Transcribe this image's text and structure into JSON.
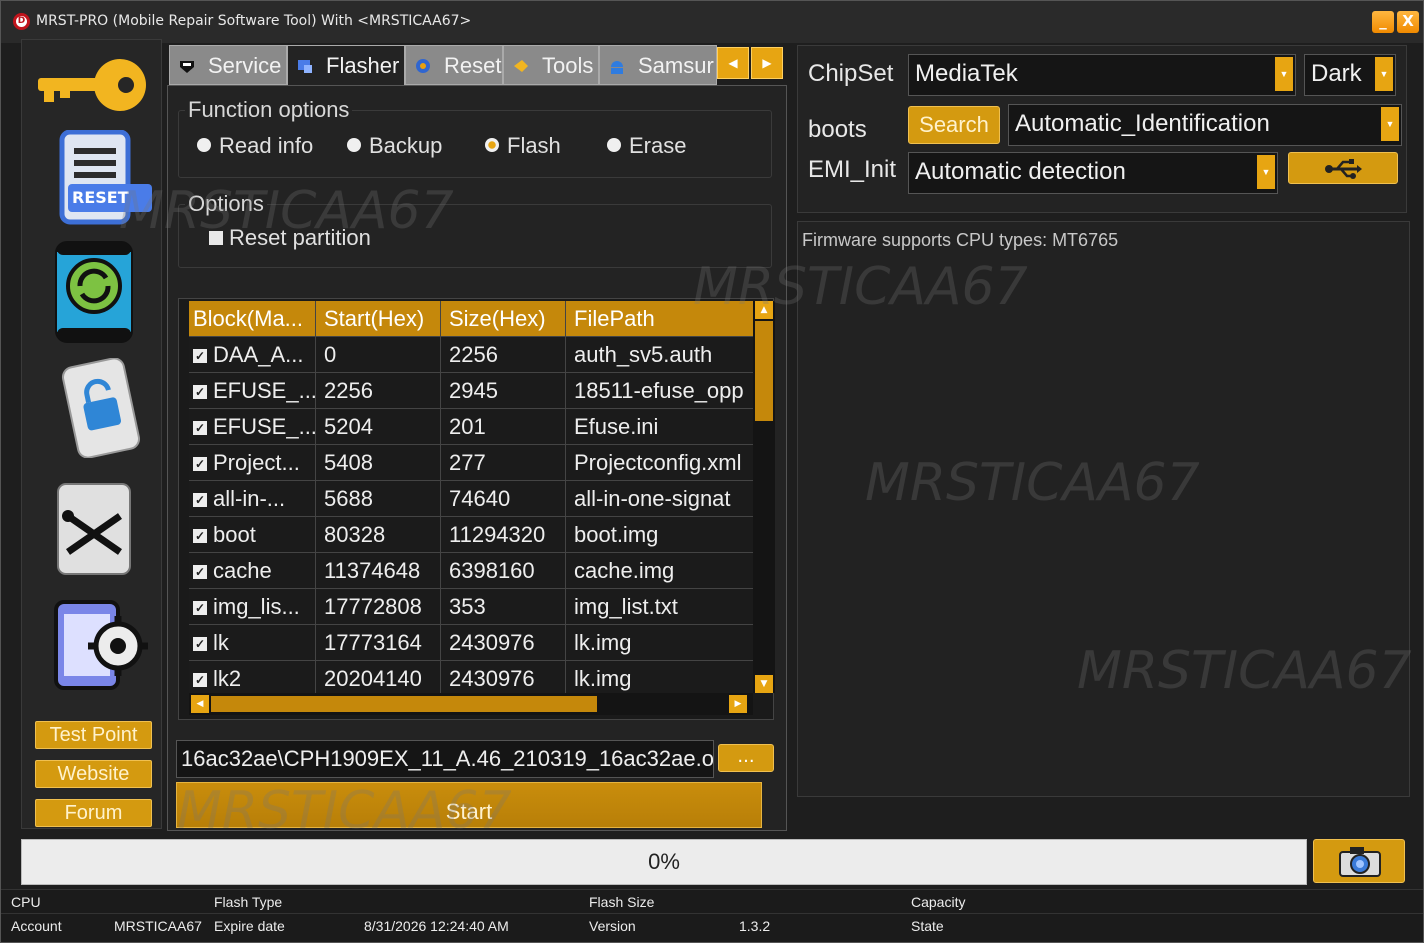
{
  "window": {
    "title": "MRST-PRO (Mobile Repair Software Tool)    With <MRSTICAA67>",
    "minimize_label": "_",
    "close_label": "X"
  },
  "sidebar": {
    "icons": [
      "key-icon",
      "reset-document-icon",
      "phone-sync-icon",
      "phone-unlock-icon",
      "tools-icon",
      "phone-settings-icon"
    ],
    "reset_badge": "RESET",
    "buttons": {
      "test_point": "Test Point",
      "website": "Website",
      "forum": "Forum"
    }
  },
  "tabs": [
    {
      "label": "Service",
      "icon": "service-icon",
      "active": false
    },
    {
      "label": "Flasher",
      "icon": "flasher-icon",
      "active": true
    },
    {
      "label": "Reset",
      "icon": "reset-icon",
      "active": false
    },
    {
      "label": "Tools",
      "icon": "tools-icon",
      "active": false
    },
    {
      "label": "Samsur",
      "icon": "android-icon",
      "active": false
    }
  ],
  "tab_scroll": {
    "left": "◀",
    "right": "▶"
  },
  "function_options": {
    "title": "Function options",
    "options": [
      {
        "label": "Read info",
        "selected": false
      },
      {
        "label": "Backup",
        "selected": false
      },
      {
        "label": "Flash",
        "selected": true
      },
      {
        "label": "Erase",
        "selected": false
      }
    ]
  },
  "options": {
    "title": "Options",
    "reset_partition": "Reset partition"
  },
  "grid": {
    "headers": [
      "Block(Ma...",
      "Start(Hex)",
      "Size(Hex)",
      "FilePath"
    ],
    "rows": [
      {
        "block": "DAA_A...",
        "start": "0",
        "size": "2256",
        "path": "auth_sv5.auth"
      },
      {
        "block": "EFUSE_...",
        "start": "2256",
        "size": "2945",
        "path": "18511-efuse_opp"
      },
      {
        "block": "EFUSE_...",
        "start": "5204",
        "size": "201",
        "path": "Efuse.ini"
      },
      {
        "block": "Project...",
        "start": "5408",
        "size": "277",
        "path": "Projectconfig.xml"
      },
      {
        "block": "all-in-...",
        "start": "5688",
        "size": "74640",
        "path": "all-in-one-signat"
      },
      {
        "block": "boot",
        "start": "80328",
        "size": "11294320",
        "path": "boot.img"
      },
      {
        "block": "cache",
        "start": "11374648",
        "size": "6398160",
        "path": "cache.img"
      },
      {
        "block": "img_lis...",
        "start": "17772808",
        "size": "353",
        "path": "img_list.txt"
      },
      {
        "block": "lk",
        "start": "17773164",
        "size": "2430976",
        "path": "lk.img"
      },
      {
        "block": "lk2",
        "start": "20204140",
        "size": "2430976",
        "path": "lk.img"
      }
    ]
  },
  "firmware_path": "16ac32ae\\CPH1909EX_11_A.46_210319_16ac32ae.o",
  "browse_label": "...",
  "start_label": "Start",
  "right_panel": {
    "chipset_label": "ChipSet",
    "chipset_value": "MediaTek",
    "theme_value": "Dark",
    "boots_label": "boots",
    "search_label": "Search",
    "boots_value": "Automatic_Identification",
    "emi_label": "EMI_Init",
    "emi_value": "Automatic detection",
    "usb_icon": "usb-icon"
  },
  "log": {
    "text": "Firmware supports CPU types: MT6765"
  },
  "progress": {
    "label": "0%",
    "value": 0
  },
  "camera_icon": "camera-icon",
  "status": {
    "cpu_label": "CPU",
    "flash_type_label": "Flash Type",
    "flash_size_label": "Flash Size",
    "capacity_label": "Capacity",
    "account_label": "Account",
    "account_value": "MRSTICAA67",
    "expire_label": "Expire date",
    "expire_value": "8/31/2026 12:24:40 AM",
    "version_label": "Version",
    "version_value": "1.3.2",
    "state_label": "State"
  },
  "watermark": "MRSTICAA67",
  "colors": {
    "accent": "#d49a10",
    "background": "#1e1e1e",
    "header": "#c5880b"
  }
}
